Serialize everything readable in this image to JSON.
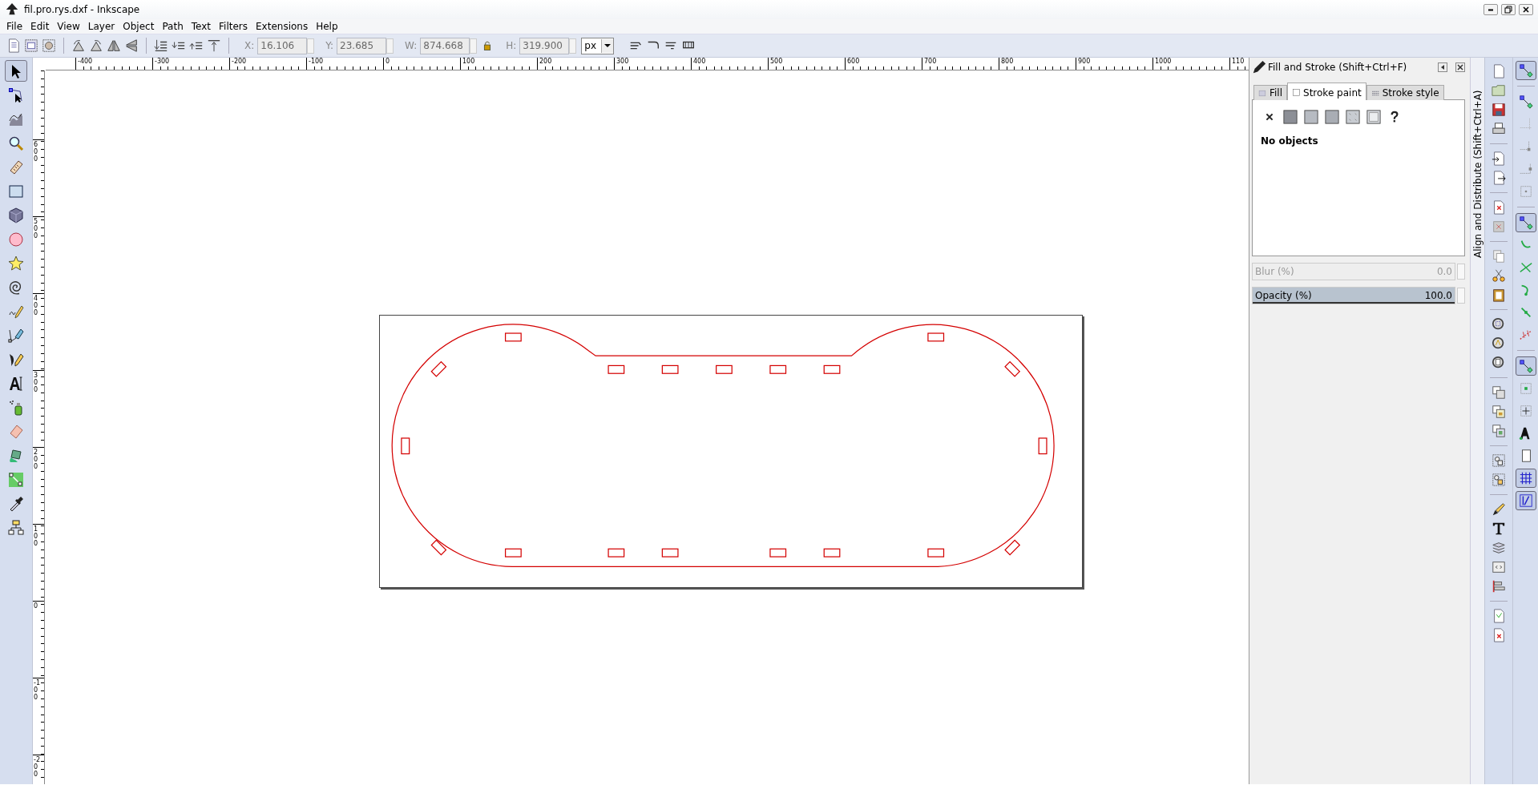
{
  "window": {
    "title": "fil.pro.rys.dxf - Inkscape"
  },
  "menu": [
    {
      "label": "File"
    },
    {
      "label": "Edit"
    },
    {
      "label": "View"
    },
    {
      "label": "Layer"
    },
    {
      "label": "Object"
    },
    {
      "label": "Path"
    },
    {
      "label": "Text"
    },
    {
      "label": "Filters"
    },
    {
      "label": "Extensions"
    },
    {
      "label": "Help"
    }
  ],
  "tool_controls": {
    "fields": [
      {
        "label": "X:",
        "value": "16.106",
        "disabled": true
      },
      {
        "label": "Y:",
        "value": "23.685",
        "disabled": true
      },
      {
        "label": "W:",
        "value": "874.668",
        "disabled": true
      },
      {
        "label": "H:",
        "value": "319.900",
        "disabled": true
      }
    ],
    "unit": "px"
  },
  "toolbox": [
    {
      "kind": "selector",
      "selected": true
    },
    {
      "kind": "node",
      "selected": false
    },
    {
      "kind": "tweak",
      "selected": false
    },
    {
      "kind": "zoom",
      "selected": false
    },
    {
      "kind": "measure",
      "selected": false
    },
    {
      "kind": "rect",
      "selected": false
    },
    {
      "kind": "box3d",
      "selected": false
    },
    {
      "kind": "ellipse",
      "selected": false
    },
    {
      "kind": "star",
      "selected": false
    },
    {
      "kind": "spiral",
      "selected": false
    },
    {
      "kind": "pencil",
      "selected": false
    },
    {
      "kind": "pen",
      "selected": false
    },
    {
      "kind": "calligraphy",
      "selected": false
    },
    {
      "kind": "text",
      "selected": false
    },
    {
      "kind": "spray",
      "selected": false
    },
    {
      "kind": "eraser",
      "selected": false
    },
    {
      "kind": "bucket",
      "selected": false
    },
    {
      "kind": "gradient",
      "selected": false
    },
    {
      "kind": "dropper",
      "selected": false
    },
    {
      "kind": "connector",
      "selected": false
    }
  ],
  "rulers": {
    "horizontal": [
      "-400",
      "-300",
      "-200",
      "-100",
      "0",
      "100",
      "200",
      "300",
      "400",
      "500",
      "600",
      "700",
      "800",
      "900",
      "1000",
      "110"
    ],
    "vertical": [
      "600",
      "500",
      "400",
      "300",
      "200",
      "100",
      "0",
      "-100",
      "-200"
    ]
  },
  "dock": {
    "title": "Fill and Stroke (Shift+Ctrl+F)",
    "tabs": [
      {
        "label": "Fill",
        "selected": false
      },
      {
        "label": "Stroke paint",
        "selected": true
      },
      {
        "label": "Stroke style",
        "selected": false
      }
    ],
    "status": "No objects",
    "blur": {
      "label": "Blur (%)",
      "value": "0.0",
      "disabled": true
    },
    "opacity": {
      "label": "Opacity (%)",
      "value": "100.0",
      "level": 1
    }
  },
  "dock_tab": {
    "label": "Align and Distribute (Shift+Ctrl+A)"
  },
  "snap_toggles": [
    {
      "on": true
    },
    {
      "on": false
    },
    {
      "on": false
    },
    {
      "on": false
    },
    {
      "on": false
    },
    {
      "on": false
    },
    {
      "on": true
    },
    {
      "on": false
    },
    {
      "on": false
    },
    {
      "on": false
    },
    {
      "on": false
    },
    {
      "on": false
    },
    {
      "on": true
    },
    {
      "on": false
    },
    {
      "on": false
    },
    {
      "on": false
    },
    {
      "on": false
    },
    {
      "on": true
    },
    {
      "on": true
    }
  ]
}
